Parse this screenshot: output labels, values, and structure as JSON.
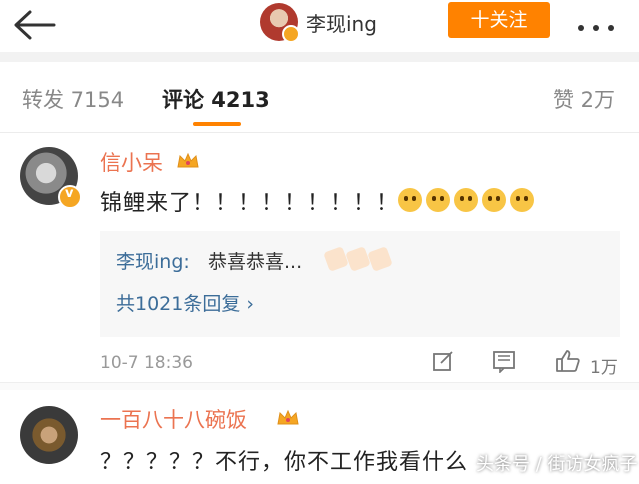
{
  "header": {
    "user_name": "李现ing",
    "follow_label": "十关注"
  },
  "tabs": {
    "repost": "转发 7154",
    "comment": "评论 4213",
    "like": "赞 2万"
  },
  "comments": [
    {
      "name": "信小呆",
      "text": "锦鲤来了！！！！！！！！！",
      "reply": {
        "author": "李现ing:",
        "text": "恭喜恭喜..."
      },
      "reply_count": "共1021条回复 ›",
      "time": "10-7 18:36",
      "likes": "1万"
    },
    {
      "name": "一百八十八碗饭",
      "text": "？？？？？不行，你不工作我看什么"
    }
  ],
  "watermark": "头条号 / 街访女疯子",
  "colors": {
    "accent": "#ff8200",
    "name_color": "#eb7350",
    "link_color": "#3c6d99"
  },
  "icons": [
    "back-arrow-icon",
    "more-dots-icon",
    "crown-icon",
    "verified-badge-icon",
    "edit-share-icon",
    "comment-icon",
    "like-thumb-icon",
    "clap-emoji-icon",
    "scared-emoji-icon"
  ]
}
